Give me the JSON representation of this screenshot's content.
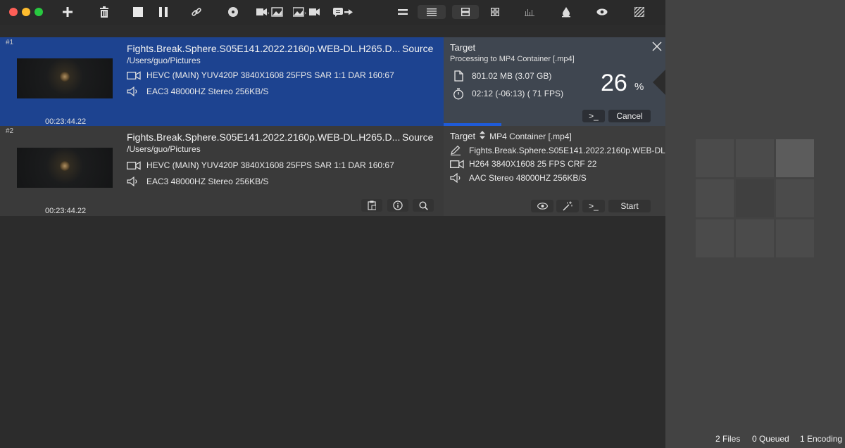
{
  "window": {
    "traffic_lights": [
      "#fe5f57",
      "#febc2e",
      "#28c840"
    ]
  },
  "toolbar": {
    "icons": [
      "add-icon",
      "trash-icon",
      "stop-icon",
      "pause-icon",
      "link-icon",
      "disc-icon",
      "video-to-image-icon",
      "image-to-video-icon",
      "export-icon",
      "compact-view-icon",
      "list-view-icon",
      "row-view-icon",
      "grid-view-icon",
      "chart-icon",
      "drop-icon",
      "eye-icon",
      "stripes-icon"
    ]
  },
  "items": [
    {
      "index": "#1",
      "filename": "Fights.Break.Sphere.S05E141.2022.2160p.WEB-DL.H265.D...",
      "source_label": "Source",
      "path": "/Users/guo/Pictures",
      "video_info": "HEVC (MAIN) YUV420P 3840X1608  25FPS  SAR 1:1 DAR 160:67",
      "audio_info": "EAC3 48000HZ Stereo 256KB/S",
      "duration": "00:23:44.22",
      "target": {
        "title": "Target",
        "processing": "Processing to MP4 Container [.mp4]",
        "size": "801.02 MB (3.07 GB)",
        "time": "02:12 (-06:13) ( 71  FPS)",
        "percent": "26",
        "percent_sign": "%",
        "progress": 0.26,
        "terminal_label": ">_",
        "cancel_label": "Cancel"
      }
    },
    {
      "index": "#2",
      "filename": "Fights.Break.Sphere.S05E141.2022.2160p.WEB-DL.H265.D...",
      "source_label": "Source",
      "path": "/Users/guo/Pictures",
      "video_info": "HEVC (MAIN) YUV420P 3840X1608  25FPS  SAR 1:1 DAR 160:67",
      "audio_info": "EAC3 48000HZ Stereo 256KB/S",
      "duration": "00:23:44.22",
      "target": {
        "title": "Target",
        "container": "MP4 Container [.mp4]",
        "output_name": "Fights.Break.Sphere.S05E141.2022.2160p.WEB-DL...",
        "video": "H264 3840X1608 25 FPS CRF 22",
        "audio": "AAC Stereo 48000HZ 256KB/S",
        "terminal_label": ">_",
        "start_label": "Start"
      }
    }
  ],
  "status": {
    "files": "2 Files",
    "queued": "0 Queued",
    "encoding": "1 Encoding"
  }
}
